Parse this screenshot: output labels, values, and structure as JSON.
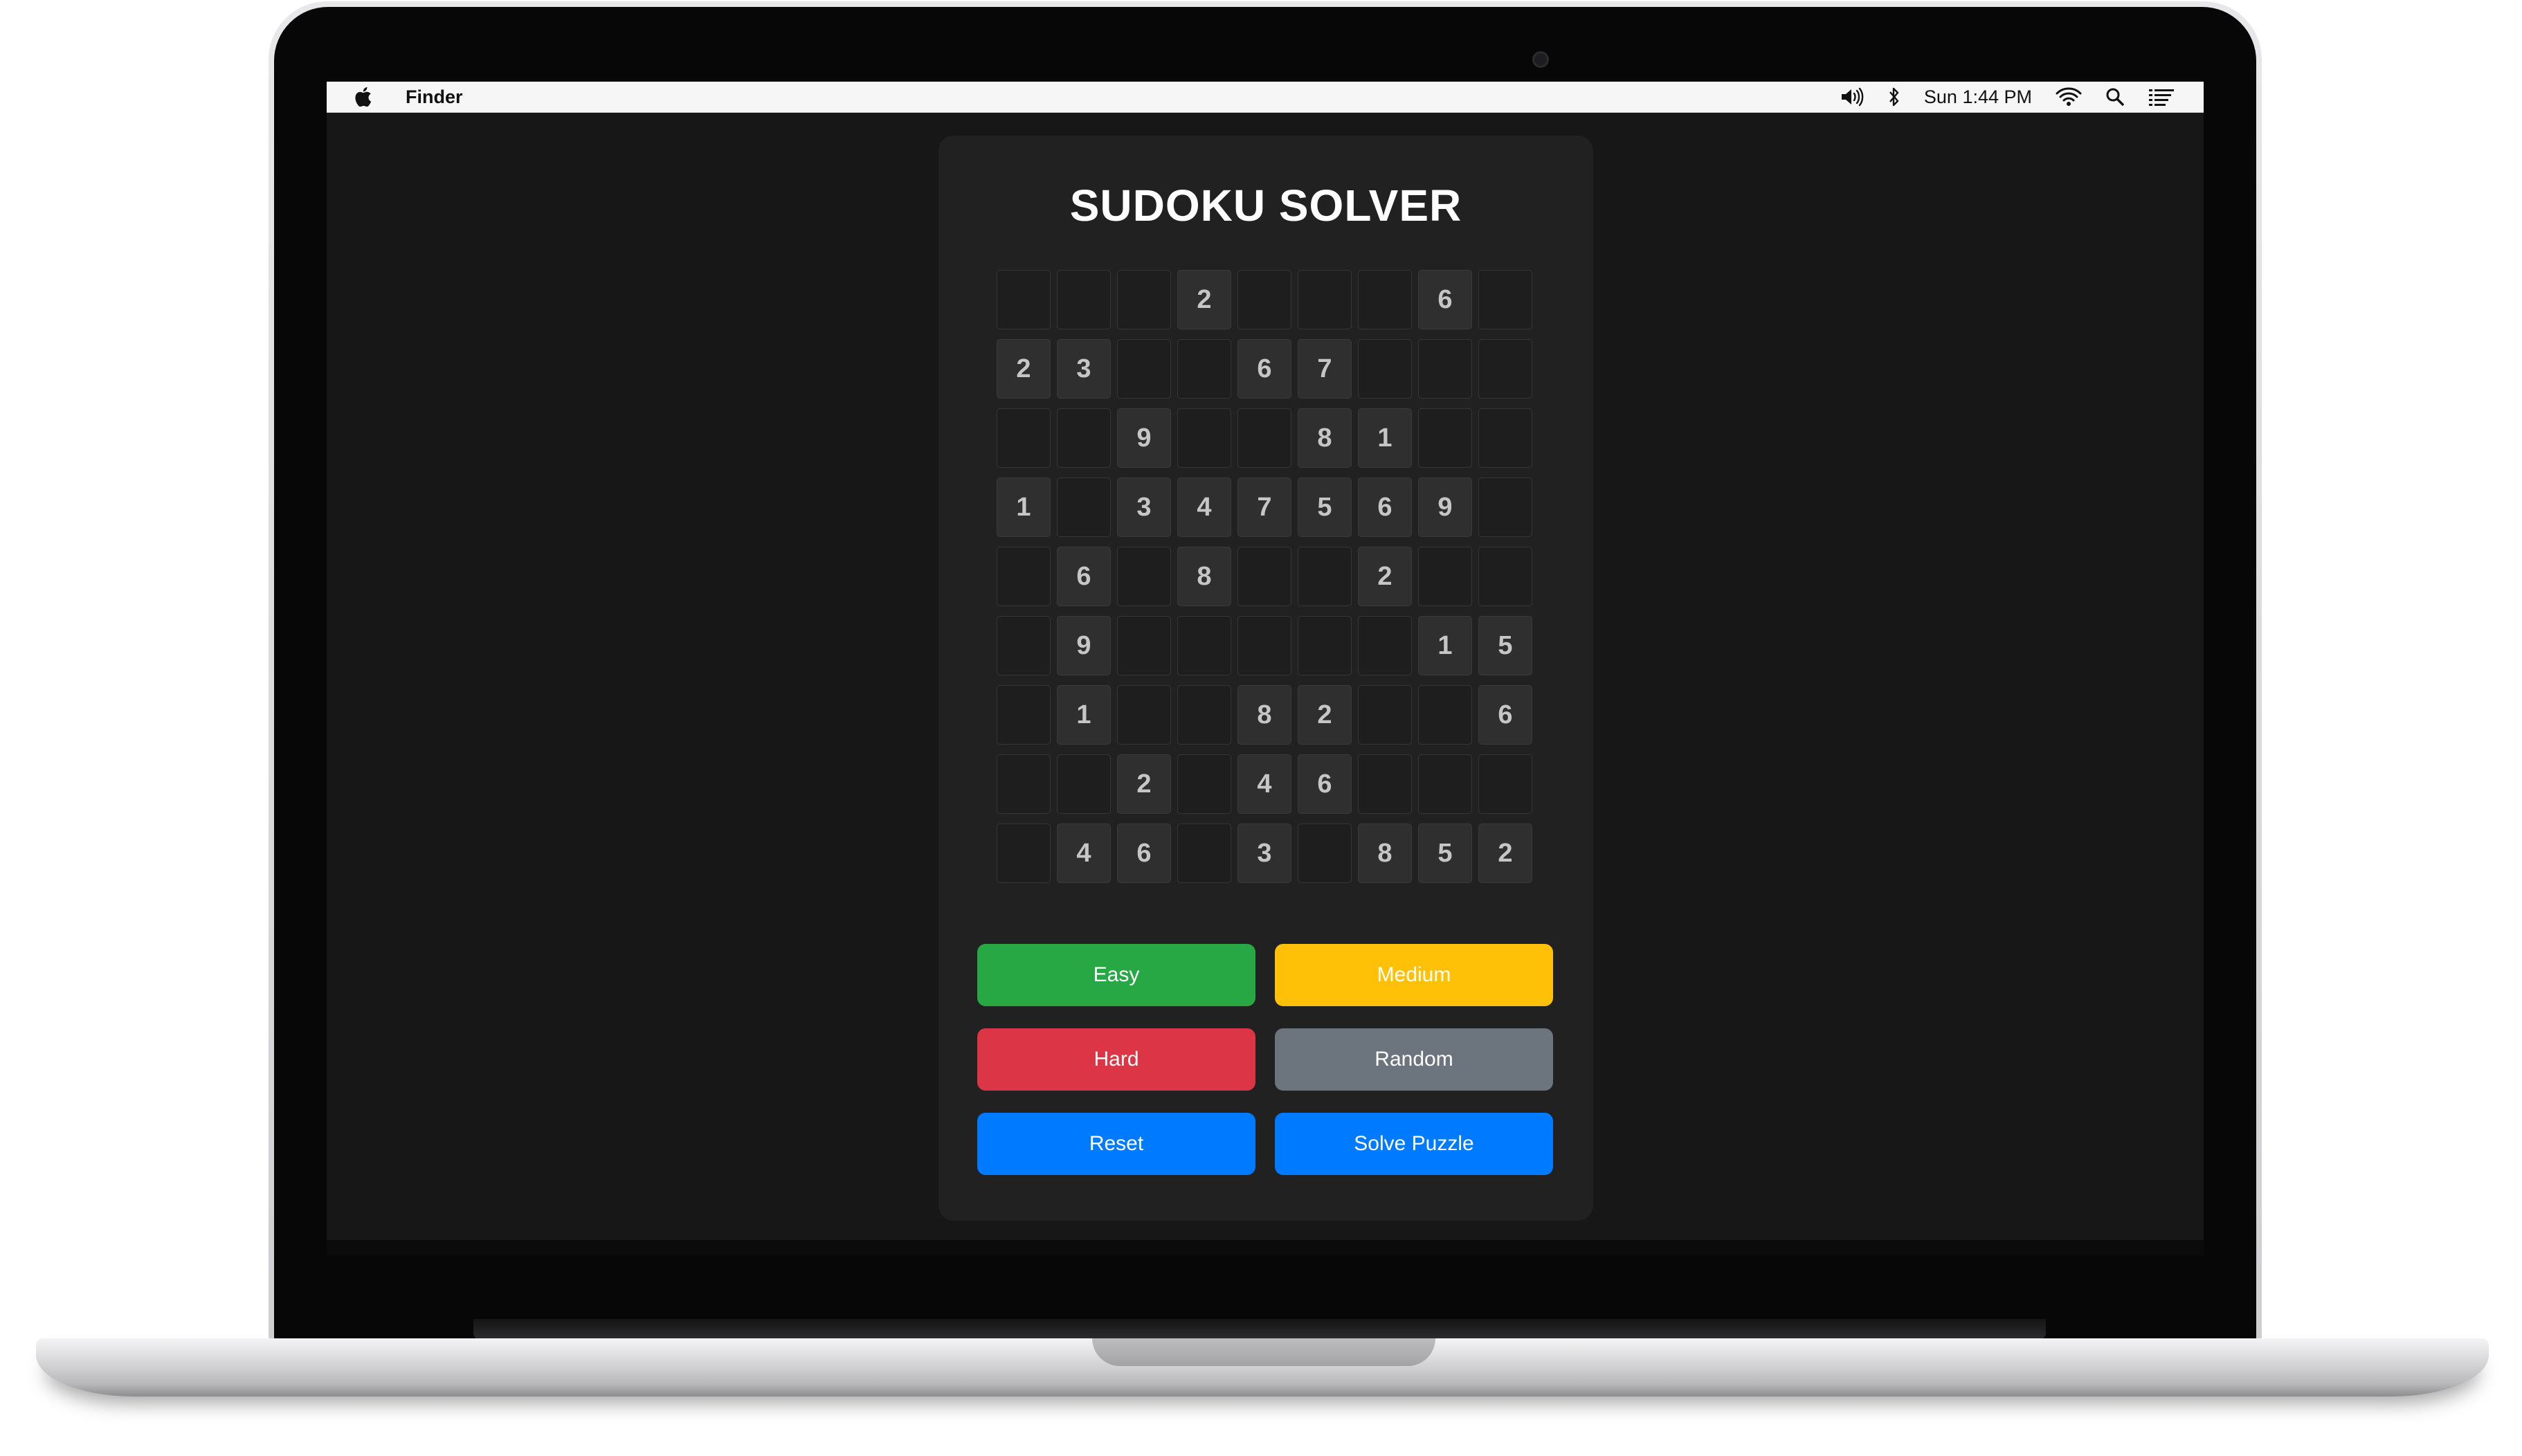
{
  "menubar": {
    "app_name": "Finder",
    "clock": "Sun 1:44 PM",
    "icons": [
      "apple-icon",
      "volume-icon",
      "bluetooth-icon",
      "wifi-icon",
      "search-icon",
      "list-icon"
    ]
  },
  "app": {
    "title": "SUDOKU SOLVER",
    "grid": [
      [
        "",
        "",
        "",
        "2",
        "",
        "",
        "",
        "6",
        ""
      ],
      [
        "2",
        "3",
        "",
        "",
        "6",
        "7",
        "",
        "",
        ""
      ],
      [
        "",
        "",
        "9",
        "",
        "",
        "8",
        "1",
        "",
        ""
      ],
      [
        "1",
        "",
        "3",
        "4",
        "7",
        "5",
        "6",
        "9",
        ""
      ],
      [
        "",
        "6",
        "",
        "8",
        "",
        "",
        "2",
        "",
        ""
      ],
      [
        "",
        "9",
        "",
        "",
        "",
        "",
        "",
        "1",
        "5"
      ],
      [
        "",
        "1",
        "",
        "",
        "8",
        "2",
        "",
        "",
        "6"
      ],
      [
        "",
        "",
        "2",
        "",
        "4",
        "6",
        "",
        "",
        ""
      ],
      [
        "",
        "4",
        "6",
        "",
        "3",
        "",
        "8",
        "5",
        "2"
      ]
    ],
    "buttons": {
      "easy": "Easy",
      "medium": "Medium",
      "hard": "Hard",
      "random": "Random",
      "reset": "Reset",
      "solve": "Solve Puzzle"
    }
  },
  "colors": {
    "easy": "#28a745",
    "medium": "#ffc107",
    "hard": "#dc3545",
    "random": "#6c757d",
    "reset": "#007bff",
    "solve": "#007bff"
  }
}
